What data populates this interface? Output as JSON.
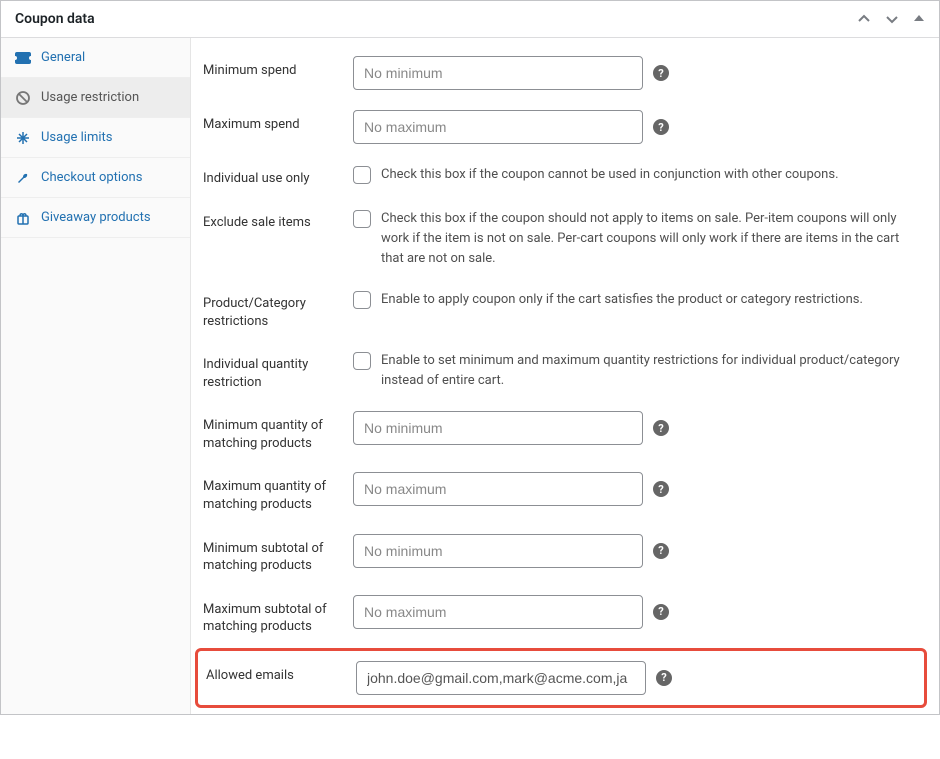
{
  "panel_title": "Coupon data",
  "sidebar": {
    "items": [
      {
        "label": "General"
      },
      {
        "label": "Usage restriction"
      },
      {
        "label": "Usage limits"
      },
      {
        "label": "Checkout options"
      },
      {
        "label": "Giveaway products"
      }
    ]
  },
  "fields": {
    "min_spend": {
      "label": "Minimum spend",
      "placeholder": "No minimum"
    },
    "max_spend": {
      "label": "Maximum spend",
      "placeholder": "No maximum"
    },
    "individual_use": {
      "label": "Individual use only",
      "desc": "Check this box if the coupon cannot be used in conjunction with other coupons."
    },
    "exclude_sale": {
      "label": "Exclude sale items",
      "desc": "Check this box if the coupon should not apply to items on sale. Per-item coupons will only work if the item is not on sale. Per-cart coupons will only work if there are items in the cart that are not on sale."
    },
    "prod_cat": {
      "label": "Product/Category restrictions",
      "desc": "Enable to apply coupon only if the cart satisfies the product or category restrictions."
    },
    "indiv_qty": {
      "label": "Individual quantity restriction",
      "desc": "Enable to set minimum and maximum quantity restrictions for individual product/category instead of entire cart."
    },
    "min_qty": {
      "label": "Minimum quantity of matching products",
      "placeholder": "No minimum"
    },
    "max_qty": {
      "label": "Maximum quantity of matching products",
      "placeholder": "No maximum"
    },
    "min_subtotal": {
      "label": "Minimum subtotal of matching products",
      "placeholder": "No minimum"
    },
    "max_subtotal": {
      "label": "Maximum subtotal of matching products",
      "placeholder": "No maximum"
    },
    "allowed_emails": {
      "label": "Allowed emails",
      "value": "john.doe@gmail.com,mark@acme.com,ja"
    }
  },
  "help_glyph": "?"
}
